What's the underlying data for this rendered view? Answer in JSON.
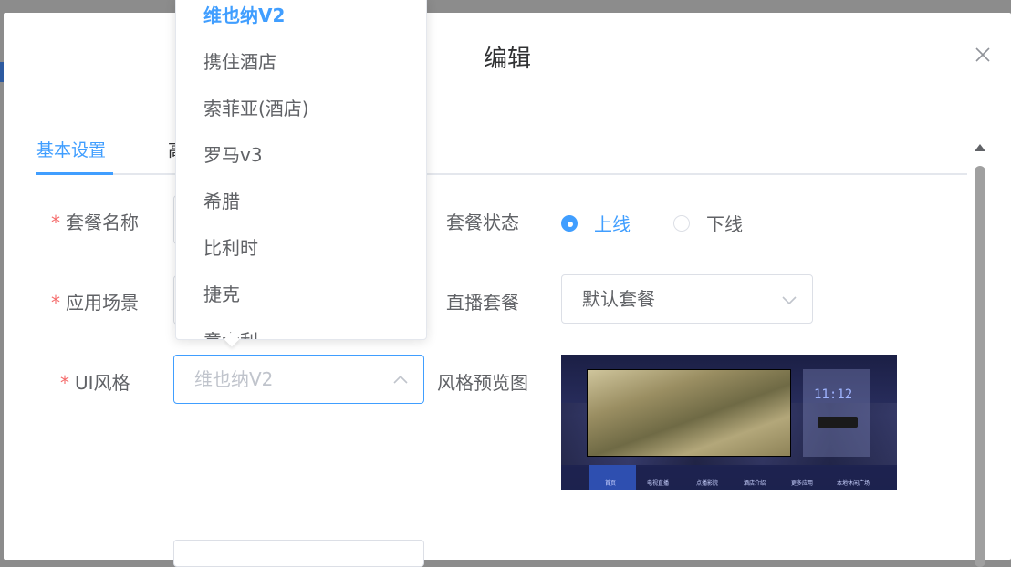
{
  "dialog": {
    "title": "编辑"
  },
  "tabs": [
    {
      "label": "基本设置",
      "active": true
    },
    {
      "label": "高",
      "active": false
    }
  ],
  "form": {
    "package_name_label": "套餐名称",
    "scene_label": "应用场景",
    "ui_style_label": "UI风格",
    "ui_style_value": "维也纳V2",
    "status_label": "套餐状态",
    "status_options": [
      {
        "label": "上线",
        "checked": true
      },
      {
        "label": "下线",
        "checked": false
      }
    ],
    "live_label": "直播套餐",
    "live_value": "默认套餐",
    "preview_label": "风格预览图"
  },
  "preview": {
    "clock_text": "11:12",
    "bottom_nav": [
      "首页",
      "电视直播",
      "点播影院",
      "酒店介绍",
      "更多应用",
      "本地休闲广场"
    ]
  },
  "dropdown": {
    "options": [
      "维也纳V2",
      "携住酒店",
      "索菲亚(酒店)",
      "罗马v3",
      "希腊",
      "比利时",
      "捷克",
      "意大利"
    ],
    "selected_index": 0
  },
  "colors": {
    "accent": "#409eff",
    "required": "#f56c6c",
    "overlay": "#8c8c8c"
  }
}
